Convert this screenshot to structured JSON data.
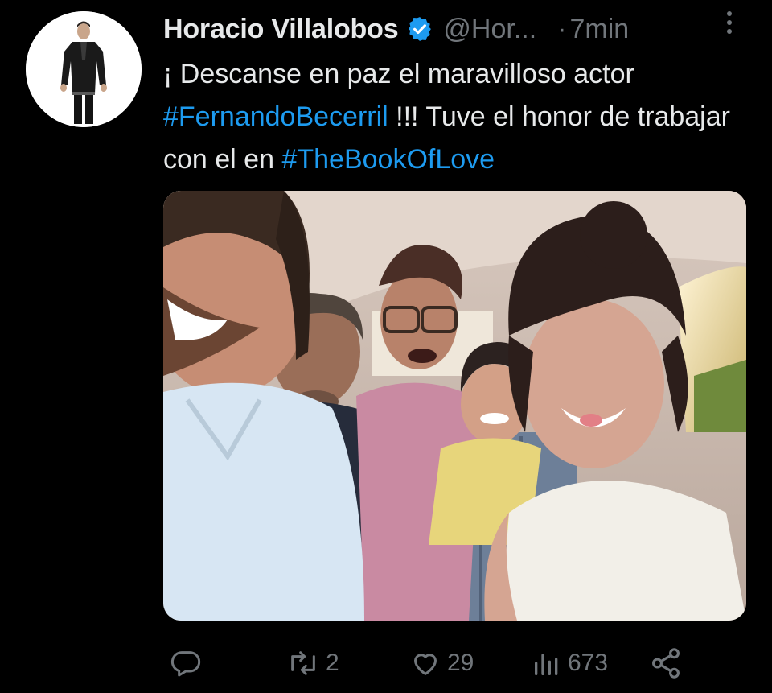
{
  "tweet": {
    "author_name": "Horacio Villalobos",
    "handle": "@Hor...",
    "separator": "·",
    "time": "7min",
    "text_parts": {
      "p1": "¡ Descanse en paz el maravilloso actor ",
      "hashtag1": "#FernandoBecerril",
      "p2": " !!! Tuve el honor de trabajar con el en ",
      "hashtag2": "#TheBookOfLove"
    }
  },
  "actions": {
    "reply_count": "",
    "retweet_count": "2",
    "like_count": "29",
    "views_count": "673"
  },
  "icons": {
    "verified": "verified-badge-icon",
    "more": "more-options-icon",
    "reply": "reply-icon",
    "retweet": "retweet-icon",
    "like": "heart-icon",
    "views": "views-icon",
    "share": "share-icon"
  },
  "colors": {
    "background": "#000000",
    "text": "#e7e9ea",
    "muted": "#71767b",
    "link": "#1d9bf0",
    "verified": "#1d9bf0"
  }
}
